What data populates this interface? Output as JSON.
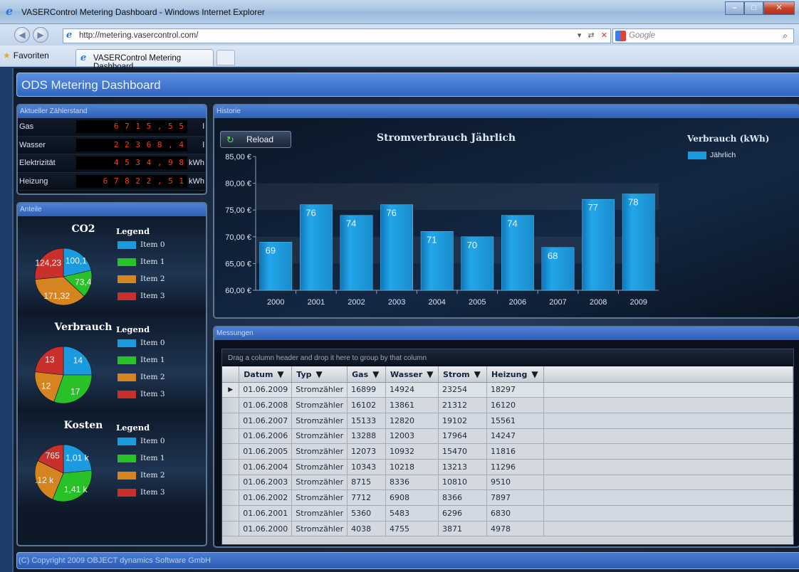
{
  "window": {
    "title": "VASERControl Metering Dashboard - Windows Internet Explorer",
    "url": "http://metering.vasercontrol.com/",
    "search_placeholder": "Google",
    "favorites_label": "Favoriten",
    "tab_label": "VASERControl Metering Dashboard"
  },
  "app": {
    "title": "ODS Metering Dashboard",
    "footer": "(C) Copyright 2009 OBJECT dynamics Software GmbH"
  },
  "zaehlerstand": {
    "header": "Aktueller Zählerstand",
    "rows": [
      {
        "label": "Gas",
        "value": "6 7 1 5 , 5 5",
        "unit": "l"
      },
      {
        "label": "Wasser",
        "value": "2 2 3 6 8 , 4",
        "unit": "l"
      },
      {
        "label": "Elektrizität",
        "value": "4 5 3 4 , 9 8",
        "unit": "kWh"
      },
      {
        "label": "Heizung",
        "value": "6 7 8 2 2 , 5 1",
        "unit": "kWh"
      }
    ]
  },
  "anteile": {
    "header": "Anteile",
    "legend_title": "Legend",
    "legend_items": [
      "Item 0",
      "Item 1",
      "Item 2",
      "Item 3"
    ],
    "colors": [
      "#1a9be0",
      "#28c228",
      "#d5841f",
      "#c9302c"
    ],
    "pies": [
      {
        "title": "CO2",
        "labels": [
          "100,1",
          "73,4",
          "171,32",
          "124,23"
        ],
        "values": [
          100.1,
          73.4,
          171.32,
          124.23
        ]
      },
      {
        "title": "Verbrauch",
        "labels": [
          "14",
          "17",
          "12",
          "13"
        ],
        "values": [
          14,
          17,
          12,
          13
        ]
      },
      {
        "title": "Kosten",
        "labels": [
          "1,01 k",
          "1,41 k",
          ".12 k",
          "765"
        ],
        "values": [
          1010,
          1410,
          1120,
          765
        ]
      }
    ]
  },
  "historie": {
    "header": "Historie",
    "reload_label": "Reload",
    "legend_title": "Verbrauch (kWh)",
    "legend_item": "Jährlich",
    "chart_data": {
      "type": "bar",
      "title": "Stromverbrauch Jährlich",
      "categories": [
        "2000",
        "2001",
        "2002",
        "2003",
        "2004",
        "2005",
        "2006",
        "2007",
        "2008",
        "2009"
      ],
      "series": [
        {
          "name": "Jährlich",
          "values": [
            69,
            76,
            74,
            76,
            71,
            70,
            74,
            68,
            77,
            78
          ]
        }
      ],
      "ylim": [
        60,
        85
      ],
      "yticks": [
        "60,00 €",
        "65,00 €",
        "70,00 €",
        "75,00 €",
        "80,00 €",
        "85,00 €"
      ],
      "color": "#1a9be0"
    }
  },
  "messungen": {
    "header": "Messungen",
    "group_hint": "Drag a column header and drop it here to group by that column",
    "columns": [
      "Datum",
      "Typ",
      "Gas",
      "Wasser",
      "Strom",
      "Heizung"
    ],
    "rows": [
      [
        "01.06.2009",
        "Stromzähler",
        "16899",
        "14924",
        "23254",
        "18297"
      ],
      [
        "01.06.2008",
        "Stromzähler",
        "16102",
        "13861",
        "21312",
        "16120"
      ],
      [
        "01.06.2007",
        "Stromzähler",
        "15133",
        "12820",
        "19102",
        "15561"
      ],
      [
        "01.06.2006",
        "Stromzähler",
        "13288",
        "12003",
        "17964",
        "14247"
      ],
      [
        "01.06.2005",
        "Stromzähler",
        "12073",
        "10932",
        "15470",
        "11816"
      ],
      [
        "01.06.2004",
        "Stromzähler",
        "10343",
        "10218",
        "13213",
        "11296"
      ],
      [
        "01.06.2003",
        "Stromzähler",
        "8715",
        "8336",
        "10810",
        "9510"
      ],
      [
        "01.06.2002",
        "Stromzähler",
        "7712",
        "6908",
        "8366",
        "7897"
      ],
      [
        "01.06.2001",
        "Stromzähler",
        "5360",
        "5483",
        "6296",
        "6830"
      ],
      [
        "01.06.2000",
        "Stromzähler",
        "4038",
        "4755",
        "3871",
        "4978"
      ]
    ]
  }
}
